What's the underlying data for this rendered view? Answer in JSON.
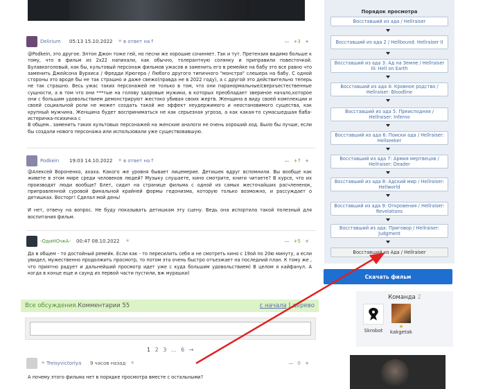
{
  "comments": [
    {
      "author": "Delirium",
      "date": "05:13 15.10.2022",
      "reply_label": "в ответ на",
      "score_minus": "—",
      "score_value": "+3",
      "score_plus": "+",
      "text": "@Podkein, это другое. Элтон Джон тоже гей, но песни же хорошие сочиняет. Так и тут. Претензия видимо больше к тому, что в фильм из 2х22 напихали, как обычно, толерантную солянку и приправили повесточкой. Булавкоголовый, как бы, культовый персонаж фильмов ужасов и заменить его в ремейке на бабу это все равно что заменить Джейсона Вурхиса / Фредди Крюгера / Любого другого типичного \"монстра\" слешера на бабу. С одной стороны это вроде бы не так страшно и даже свежо(правда не в 2022 году), а с другой это действительно теперь не так страшно. Весь ужас таких персонажей не только в том, что они паранормальные/сверхъестественные сущности, а в том что они ***тые на голову здоровые мужики, в которых преобладает звериное начало,которое они с большим удовольствием демонстрируют жестоко убивая своих жертв. Женщина в виду своей комплекции и своей социальной роли не может создать такой же эффект неудержимого и неостановимого существа, как крупный мужчина. Женщина будет восприниматься не как серьезная угроза, а как какая-то сумасшедшая баба-истеричка-психичка с",
      "text2": "В общем.. заменить таких культовых персонажей на женские аналоги не очень хороший ход. Было бы лучше, если бы создали нового персонажа или использовали уже существовавшую."
    },
    {
      "author": "Podkein",
      "date": "19:03 14.10.2022",
      "reply_label": "в ответ на",
      "score_minus": "—",
      "score_value": "+7",
      "score_plus": "+",
      "text": "@Алексей Вороненко, ахаха. Какого же уровня бывает лицемерие. Детишек вдруг вспомнили. Вы вообще как живете в этом мире среди человеков людей? Музыку слушаете, кино смотрите, книги читаете? В курсе, что их производят люди вообще? Блет, сидит на странице фильма с одной из самых жесточайших расчлененок, приправленной суровой финальной крайней формы гедонизма, которую только возможно, и рассуждает о детишках. Восторг! Сделал мой день!",
      "text2": "И нет, отвечу на вопрос. Не буду показывать детишкам эту сцену. Ведь она испортила такой полезный для воспитания фильм."
    },
    {
      "author": "-ОдиНОчкА-",
      "date": "00:47 08.10.2022",
      "reply_label": "",
      "score_minus": "—",
      "score_value": "+5",
      "score_plus": "+",
      "text": "Да в общем - то достойный ремейк. Если как - то пересилить себя и не смотреть кино с 19ой по 20ю минуту, а если увидел, мужественно продолжить просмотр, то потом эта очень быстро отъезжает на последний план. К тому же , что приятно радует и дальнейший просмотр идет уже с куда большим удовольствием) В целом я кайфанул. А когда в конце еще и саунд из первой части пустили, вж мурашки)"
    },
    {
      "author": "Treisyvictoriya",
      "date": "9 часов назад",
      "reply_label": "",
      "score_minus": "—",
      "score_value": "0",
      "score_plus": "+",
      "text": "А почему этого фильма нет в порядке просмотра вместе с остальными?"
    }
  ],
  "discussion": {
    "all_label": "Все обсуждения.",
    "comments_label": "Комментарии 55",
    "sort_label": "с начала",
    "sep": "|",
    "tree_label": "дерево"
  },
  "pager": [
    "1",
    "2",
    "3",
    "...",
    "6",
    "→"
  ],
  "sidebar": {
    "title": "Порядок просмотра",
    "items": [
      "Восставший из ада / Hellraiser",
      "Восставший из ада 2 / Hellbound: Hellraiser II",
      "Восставший из ада 3: Ад на Земле / Hellraiser III: Hell on Earth",
      "Восставший из ада 4: Кровное родство / Hellraiser: Bloodline",
      "Восставший из ада 5: Преисподняя / Hellraiser: Inferno",
      "Восставший из ада 6: Поиски ада / Hellraiser: Hellseeker",
      "Восставший из ада 7: Армия мертвецов / Hellraiser: Deader",
      "Восставший из ада 8: Адский мир / Hellraiser: Hellworld",
      "Восставший из ада 9: Откровения / Hellraiser: Revelations",
      "Восставший из ада: Приговор / Hellraiser: Judgment",
      "Восставший из Ада / Hellraiser"
    ],
    "current_index": 10
  },
  "download_label": "Скачать фильм",
  "team": {
    "title": "Команда",
    "count": "2",
    "members": [
      "Skrobot",
      "kakgetak"
    ]
  },
  "colors": {
    "accent": "#1e6fd0",
    "link": "#5b6fa4",
    "discussion_bar": "#dcf3c8",
    "arrow": "#e02020"
  }
}
